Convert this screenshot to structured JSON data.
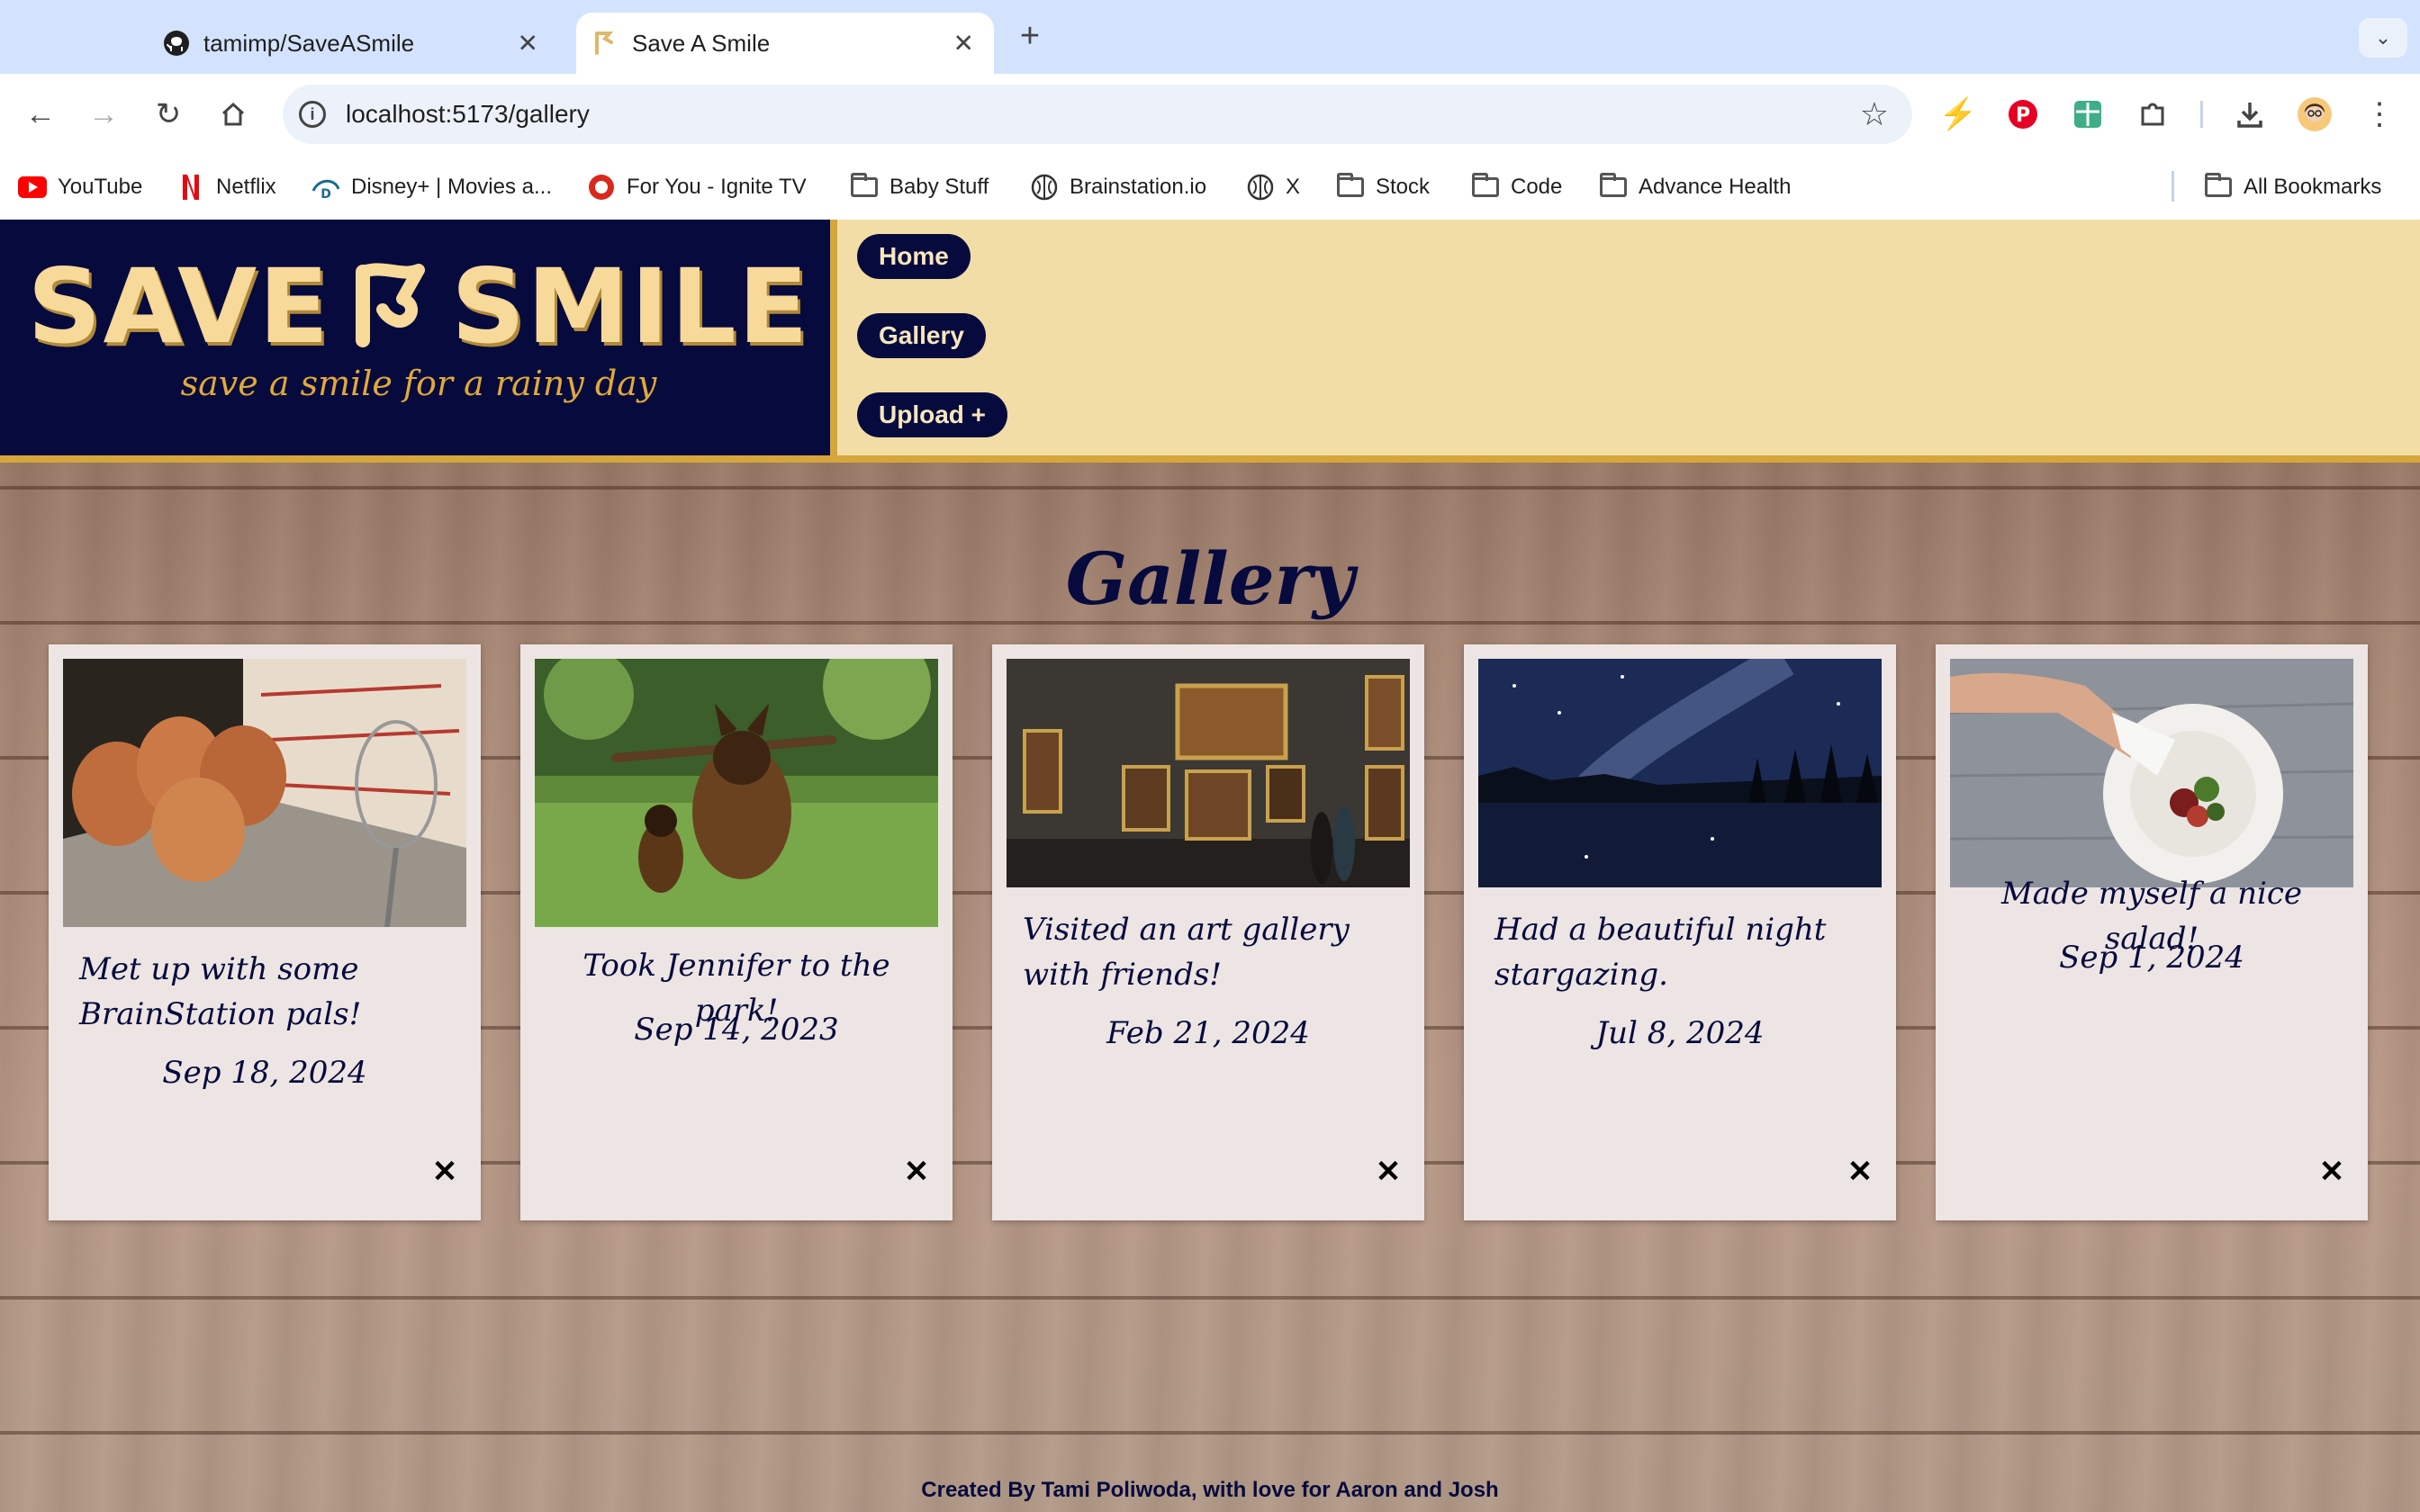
{
  "browser": {
    "tabs": [
      {
        "title": "tamimp/SaveASmile",
        "favicon": "github-icon",
        "active": false
      },
      {
        "title": "Save A Smile",
        "favicon": "save-a-smile-logo-icon",
        "active": true
      }
    ],
    "address": "localhost:5173/gallery",
    "bookmarks": [
      {
        "label": "YouTube",
        "icon": "youtube-icon"
      },
      {
        "label": "Netflix",
        "icon": "netflix-icon"
      },
      {
        "label": "Disney+ | Movies a...",
        "icon": "disney-icon"
      },
      {
        "label": "For You - Ignite TV",
        "icon": "ignite-icon"
      },
      {
        "label": "Baby Stuff",
        "icon": "folder-icon"
      },
      {
        "label": "Brainstation.io",
        "icon": "brain-icon"
      },
      {
        "label": "X",
        "icon": "brain-icon"
      },
      {
        "label": "Stock",
        "icon": "folder-icon"
      },
      {
        "label": "Code",
        "icon": "folder-icon"
      },
      {
        "label": "Advance Health",
        "icon": "folder-icon"
      }
    ],
    "all_bookmarks": "All Bookmarks"
  },
  "site": {
    "logo_left": "SAVE",
    "logo_right": "SMILE",
    "tagline": "save a smile for a rainy day",
    "nav": {
      "home": "Home",
      "gallery": "Gallery",
      "upload": "Upload +"
    },
    "page_title": "Gallery",
    "cards": [
      {
        "caption": "Met up with some BrainStation pals!",
        "date": "Sep 18, 2024",
        "photo": "eggs-and-whisk-photo"
      },
      {
        "caption": "Took Jennifer to the park!",
        "date": "Sep 14, 2023",
        "photo": "dogs-in-park-photo"
      },
      {
        "caption": "Visited an art gallery with friends!",
        "date": "Feb 21, 2024",
        "photo": "art-gallery-photo"
      },
      {
        "caption": "Had a beautiful night stargazing.",
        "date": "Jul 8, 2024",
        "photo": "night-sky-lake-photo"
      },
      {
        "caption": "Made myself a nice salad!",
        "date": "Sep 1, 2024",
        "photo": "salad-plate-photo"
      }
    ],
    "delete_symbol": "✕",
    "footer": "Created By Tami Poliwoda, with love for Aaron and Josh"
  },
  "colors": {
    "navy": "#070a3d",
    "cream": "#f3dda7",
    "gold": "#d6a63a",
    "card": "#ece5e3"
  }
}
